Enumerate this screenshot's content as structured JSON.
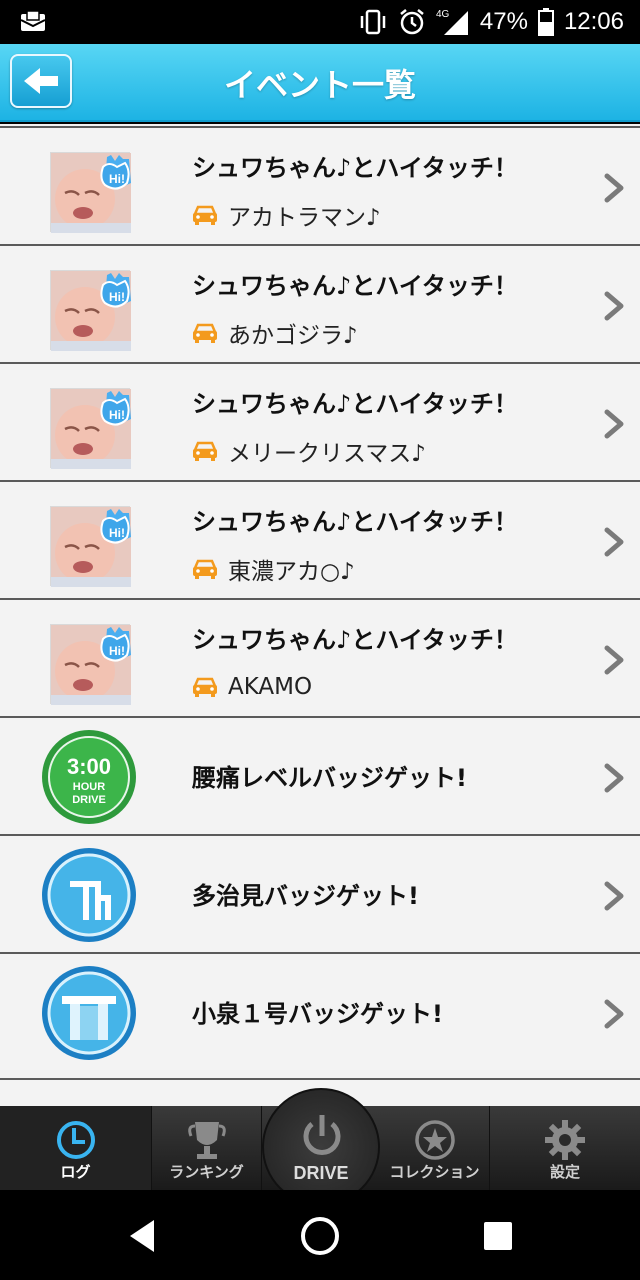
{
  "status": {
    "network": "4G",
    "battery": "47%",
    "time": "12:06"
  },
  "header": {
    "title": "イベント一覧",
    "back_label": "back"
  },
  "events": [
    {
      "title": "シュワちゃん♪とハイタッチ！",
      "sub": "アカトラマン♪",
      "kind": "photo"
    },
    {
      "title": "シュワちゃん♪とハイタッチ！",
      "sub": "あかゴジラ♪",
      "kind": "photo"
    },
    {
      "title": "シュワちゃん♪とハイタッチ！",
      "sub": "メリークリスマス♪",
      "kind": "photo"
    },
    {
      "title": "シュワちゃん♪とハイタッチ！",
      "sub": "東濃アカ○♪",
      "kind": "photo"
    },
    {
      "title": "シュワちゃん♪とハイタッチ！",
      "sub": "AKAMO",
      "kind": "photo"
    },
    {
      "title": "腰痛レベルバッジゲット!",
      "kind": "badge-green",
      "badge": {
        "line1": "3:00",
        "line2": "HOUR",
        "line3": "DRIVE"
      }
    },
    {
      "title": "多治見バッジゲット!",
      "kind": "badge-blue-junction"
    },
    {
      "title": "小泉１号バッジゲット!",
      "kind": "badge-blue-bridge"
    }
  ],
  "tabs": [
    {
      "label": "ログ",
      "icon": "clock-icon"
    },
    {
      "label": "ランキング",
      "icon": "trophy-icon"
    },
    {
      "label": "DRIVE",
      "icon": "power-icon"
    },
    {
      "label": "コレクション",
      "icon": "star-icon"
    },
    {
      "label": "設定",
      "icon": "gear-icon"
    }
  ],
  "colors": {
    "header": "#1db3e4",
    "accent_orange": "#f39a1d",
    "active_tab_icon": "#39b4f0"
  }
}
